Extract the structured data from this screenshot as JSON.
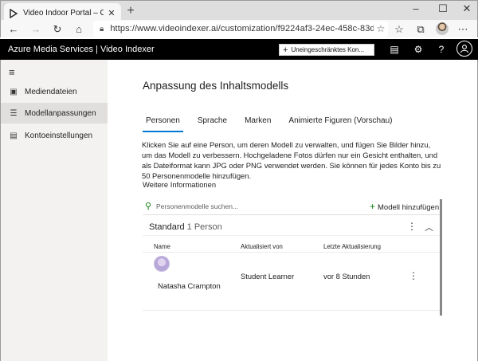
{
  "browser": {
    "tab_title": "Video Indoor Portal – Cognitive",
    "url": "https://www.videoindexer.ai/customization/f9224af3-24ec-458c-83d9..."
  },
  "header": {
    "brand": "Azure Media Services  |  Video Indexer",
    "trial_button": "Uneingeschränktes Kon..."
  },
  "sidebar": {
    "items": [
      {
        "label": "Mediendateien",
        "icon": "film-icon"
      },
      {
        "label": "Modellanpassungen",
        "icon": "sliders-icon"
      },
      {
        "label": "Kontoeinstellungen",
        "icon": "settings-doc-icon"
      }
    ]
  },
  "main": {
    "title": "Anpassung des Inhaltsmodells",
    "tabs": [
      "Personen",
      "Sprache",
      "Marken",
      "Animierte Figuren (Vorschau)"
    ],
    "description": "Klicken Sie auf eine Person, um deren Modell zu verwalten, und fügen Sie Bilder hinzu, um das Modell zu verbessern. Hochgeladene Fotos dürfen nur ein Gesicht enthalten, und als Dateiformat kann JPG oder PNG verwendet werden. Sie können für jedes Konto bis zu 50 Personenmodelle hinzufügen.",
    "learn_more": "Weitere Informationen",
    "search_placeholder": "Personenmodelle suchen...",
    "add_model": "Modell hinzufügen",
    "group": {
      "name": "Standard",
      "count": "1 Person"
    },
    "columns": [
      "Name",
      "Aktualisiert von",
      "Letzte Aktualisierung"
    ],
    "rows": [
      {
        "name": "Natasha Crampton",
        "updated_by": "Student Learner",
        "last_update": "vor 8 Stunden"
      }
    ]
  }
}
